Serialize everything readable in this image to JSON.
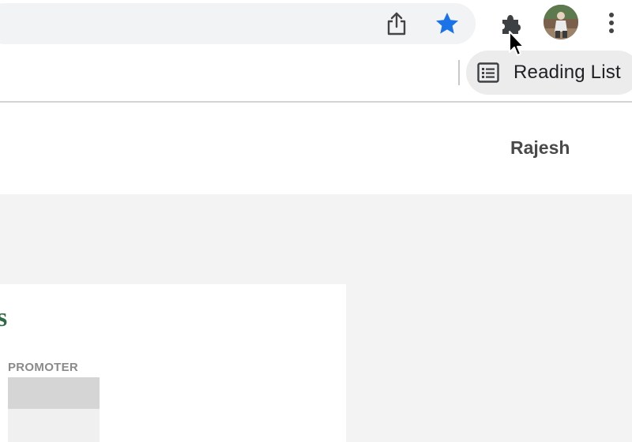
{
  "toolbar": {
    "icons": {
      "share": "share-icon",
      "bookmark": "star-icon",
      "extensions": "puzzle-icon",
      "profile": "avatar",
      "menu": "kebab-menu-icon"
    },
    "star_color": "#1a73e8"
  },
  "bookmarks_bar": {
    "reading_list_label": "Reading List"
  },
  "header": {
    "user_name": "Rajesh"
  },
  "card": {
    "heading_fragment": "s",
    "column_header": "PROMOTER",
    "accent_color": "#2f6a45"
  }
}
